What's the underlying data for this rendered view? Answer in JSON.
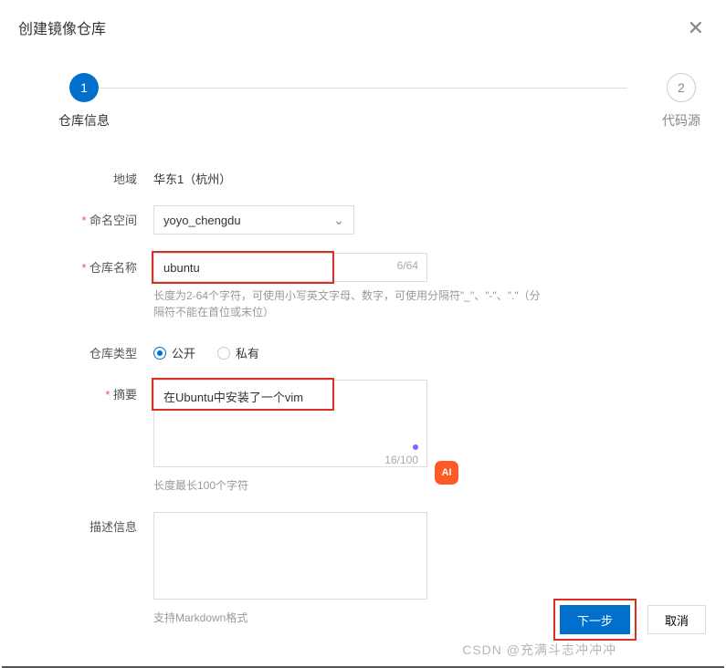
{
  "title": "创建镜像仓库",
  "stepper": {
    "step1": {
      "num": "1",
      "label": "仓库信息"
    },
    "step2": {
      "num": "2",
      "label": "代码源"
    }
  },
  "form": {
    "region": {
      "label": "地域",
      "value": "华东1（杭州）"
    },
    "namespace": {
      "label": "命名空间",
      "value": "yoyo_chengdu"
    },
    "repoName": {
      "label": "仓库名称",
      "value": "ubuntu",
      "count": "6/64",
      "help": "长度为2-64个字符，可使用小写英文字母、数字，可使用分隔符\"_\"、\"-\"、\".\"（分隔符不能在首位或末位）"
    },
    "repoType": {
      "label": "仓库类型",
      "public": "公开",
      "private": "私有"
    },
    "summary": {
      "label": "摘要",
      "value": "在Ubuntu中安装了一个vim",
      "count": "16/100",
      "help": "长度最长100个字符"
    },
    "description": {
      "label": "描述信息",
      "value": "",
      "help": "支持Markdown格式"
    }
  },
  "footer": {
    "next": "下一步",
    "cancel": "取消"
  },
  "aiBadge": "AI",
  "watermark": "CSDN @充满斗志冲冲冲"
}
